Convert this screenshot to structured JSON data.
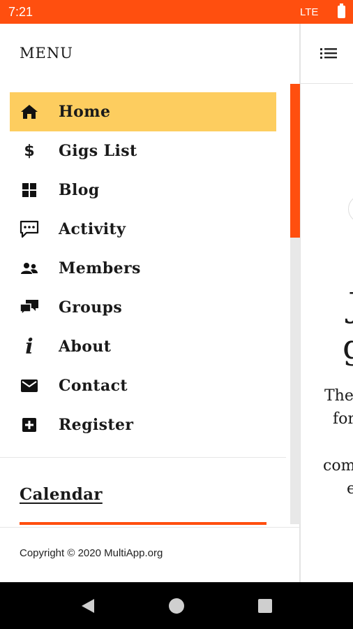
{
  "status_bar": {
    "time": "7:21",
    "network": "LTE"
  },
  "drawer": {
    "header": "MENU",
    "items": [
      {
        "label": "Home",
        "icon": "home-icon",
        "active": true
      },
      {
        "label": "Gigs List",
        "icon": "dollar-icon",
        "active": false
      },
      {
        "label": "Blog",
        "icon": "grid-icon",
        "active": false
      },
      {
        "label": "Activity",
        "icon": "chat-icon",
        "active": false
      },
      {
        "label": "Members",
        "icon": "members-icon",
        "active": false
      },
      {
        "label": "Groups",
        "icon": "groups-icon",
        "active": false
      },
      {
        "label": "About",
        "icon": "info-icon",
        "active": false
      },
      {
        "label": "Contact",
        "icon": "mail-icon",
        "active": false
      },
      {
        "label": "Register",
        "icon": "plus-box-icon",
        "active": false
      }
    ],
    "calendar_link": "Calendar",
    "footer": "Copyright © 2020 MultiApp.org"
  },
  "background_page": {
    "lines": [
      "J",
      "g",
      "The",
      "for",
      "com",
      "e"
    ]
  },
  "colors": {
    "accent": "#ff4f0f",
    "active_item": "#fdcd5f"
  }
}
